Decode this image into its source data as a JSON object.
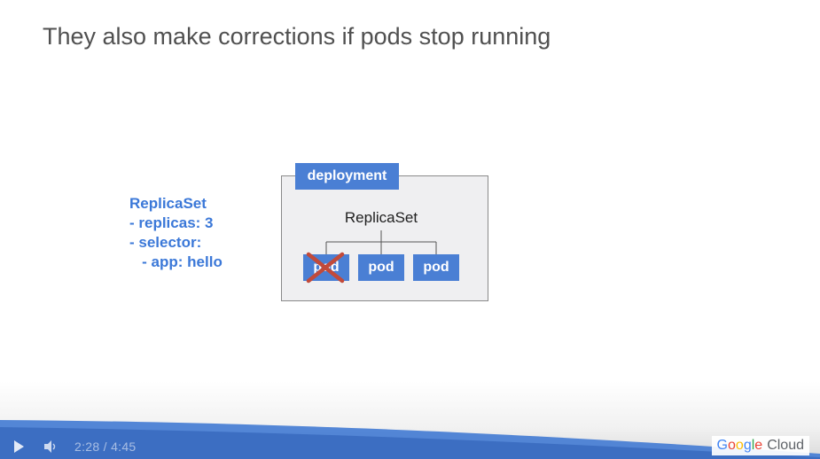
{
  "slide": {
    "title": "They also make corrections if pods stop running"
  },
  "spec": {
    "text": "ReplicaSet\n- replicas: 3\n- selector:\n   - app: hello"
  },
  "diagram": {
    "deployment_label": "deployment",
    "replicaset_label": "ReplicaSet",
    "pods": [
      "pod",
      "pod",
      "pod"
    ],
    "failed_pod_index": 0,
    "colors": {
      "box_fill": "#efeff1",
      "accent_blue": "#4a7fd4",
      "failure_red": "#c24a3a",
      "text_blue": "#3b78d8"
    }
  },
  "player": {
    "current_time": "2:28",
    "separator": "/",
    "duration": "4:45",
    "icons": [
      "play-icon",
      "volume-icon"
    ]
  },
  "brand": {
    "google_letters": [
      "G",
      "o",
      "o",
      "g",
      "l",
      "e"
    ],
    "google_colors": [
      "#4285f4",
      "#ea4335",
      "#fbbc05",
      "#4285f4",
      "#34a853",
      "#ea4335"
    ],
    "cloud": "Cloud"
  }
}
